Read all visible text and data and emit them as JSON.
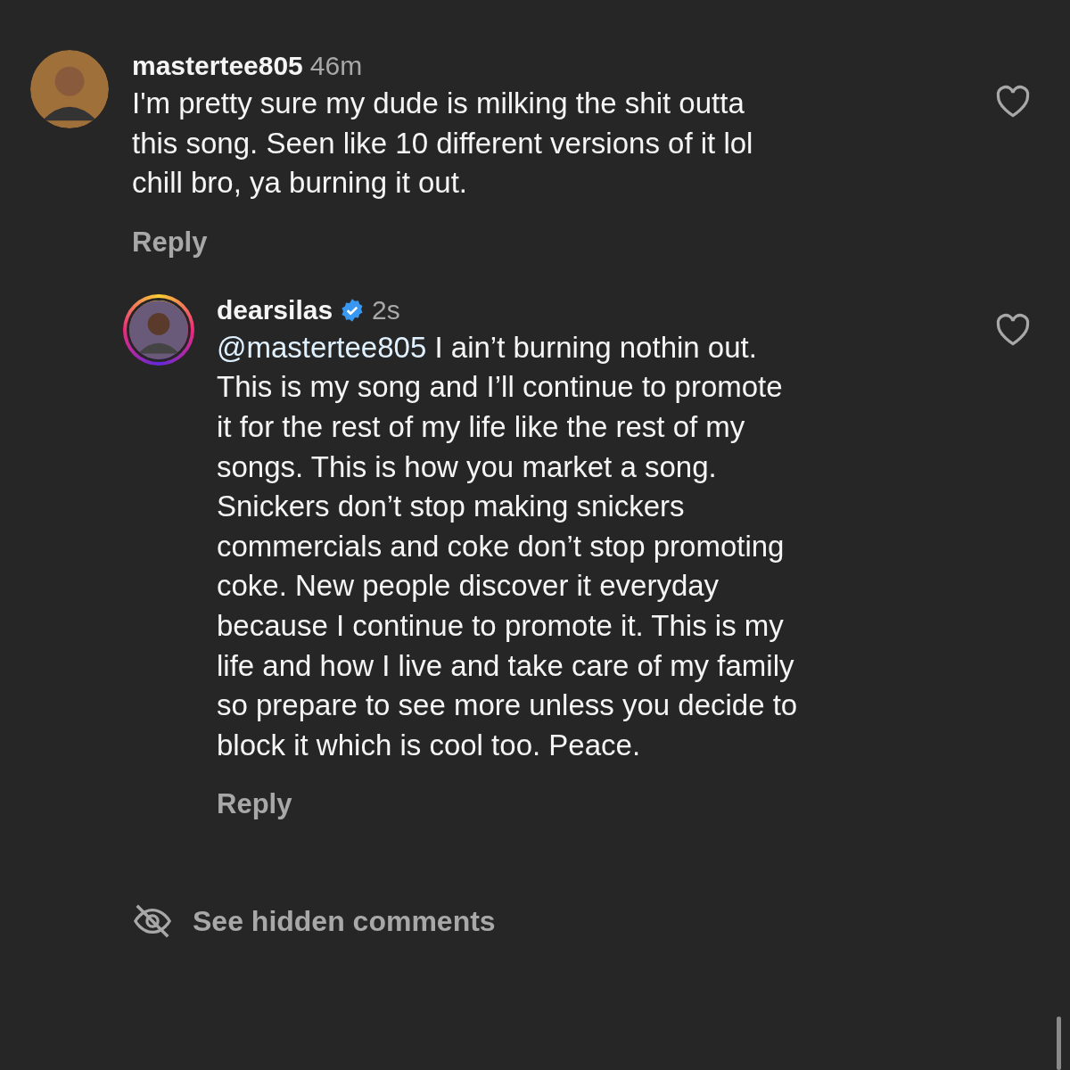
{
  "comments": [
    {
      "username": "mastertee805",
      "verified": false,
      "story_ring": false,
      "time": "46m",
      "text": "I'm pretty sure my dude is milking the shit outta\nthis song. Seen like 10 different versions of it lol\nchill bro, ya burning it out.",
      "reply_label": "Reply",
      "nested": false
    },
    {
      "username": "dearsilas",
      "verified": true,
      "story_ring": true,
      "time": "2s",
      "mention": "@mastertee805",
      "text": " I ain’t burning nothin out.\nThis is my song and I’ll continue to promote\nit for the rest of my life like the rest of my\nsongs. This is how you market a song.\nSnickers don’t stop making snickers\ncommercials and coke don’t stop promoting\ncoke. New people discover it everyday\nbecause I continue to promote it. This is my\nlife and how I live and take care of my family\nso prepare to see more unless you decide to\nblock it which is cool too. Peace.",
      "reply_label": "Reply",
      "nested": true
    }
  ],
  "hidden_comments": {
    "label": "See hidden comments"
  }
}
